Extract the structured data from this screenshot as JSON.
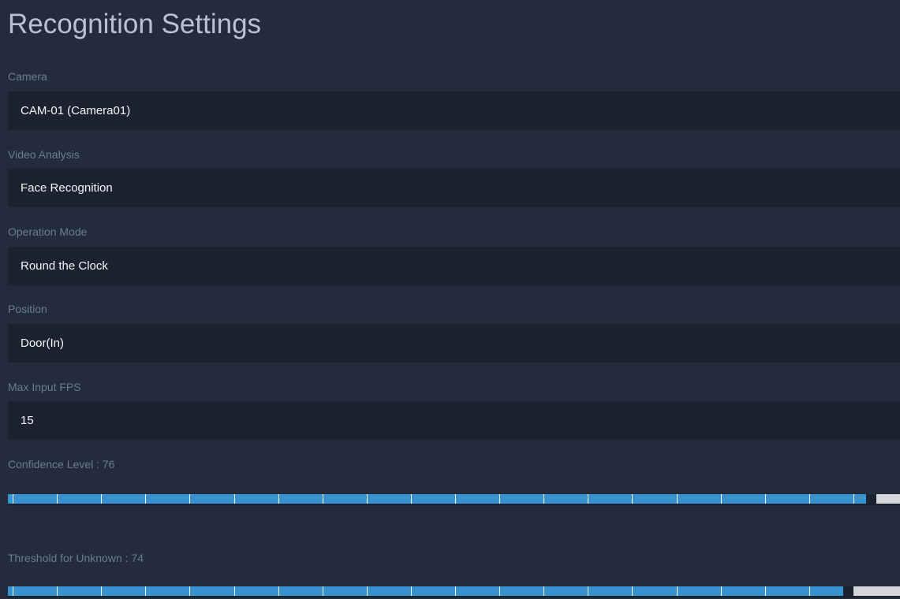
{
  "page": {
    "title": "Recognition Settings"
  },
  "fields": {
    "camera": {
      "label": "Camera",
      "value": "CAM-01 (Camera01)"
    },
    "video_analysis": {
      "label": "Video Analysis",
      "value": "Face Recognition"
    },
    "operation_mode": {
      "label": "Operation Mode",
      "value": "Round the Clock"
    },
    "position": {
      "label": "Position",
      "value": "Door(In)"
    },
    "max_input_fps": {
      "label": "Max Input FPS",
      "value": "15"
    }
  },
  "sliders": {
    "confidence": {
      "label": "Confidence Level : 76",
      "value": 76,
      "min": 0,
      "max": 79
    },
    "threshold": {
      "label": "Threshold for Unknown : 74",
      "value": 74,
      "min": 0,
      "max": 79
    }
  },
  "colors": {
    "background": "#232c3d",
    "field_background": "#1c2230",
    "label": "#6c7b92",
    "title": "#b9c2d0",
    "slider_fill": "#3793cf",
    "slider_track": "#d4d6da"
  }
}
